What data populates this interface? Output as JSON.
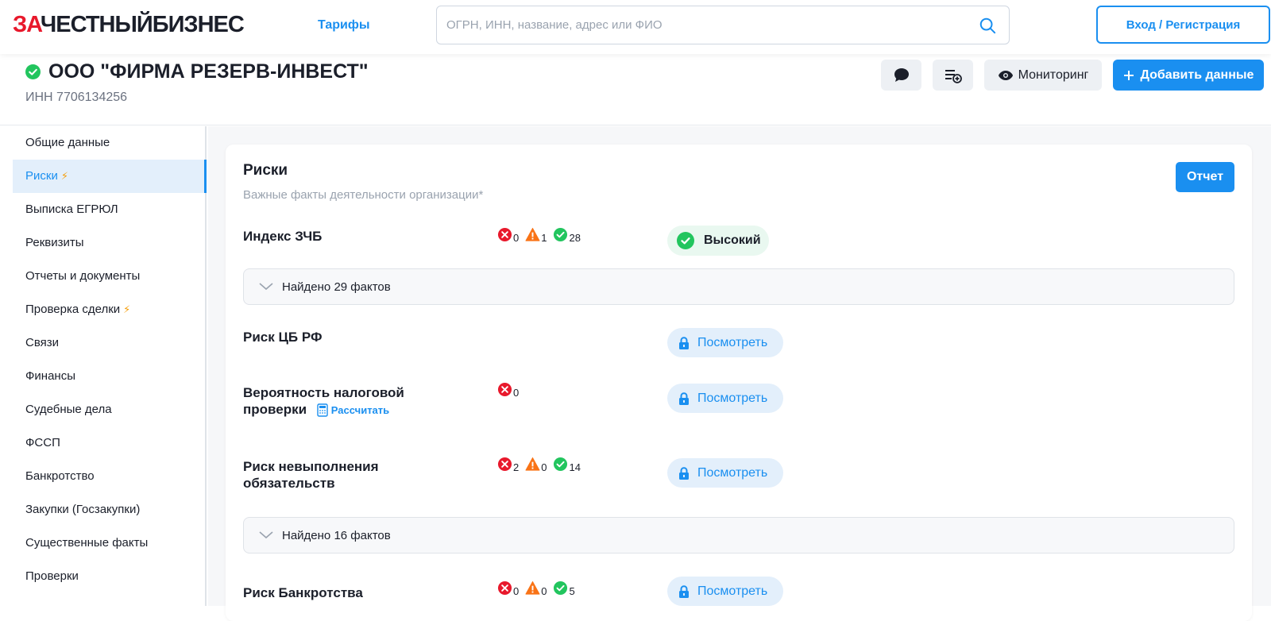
{
  "header": {
    "logo_red": "ЗА",
    "logo_dark": "ЧЕСТНЫЙБИЗНЕС",
    "tariffs": "Тарифы",
    "search_placeholder": "ОГРН, ИНН, название, адрес или ФИО",
    "login": "Вход / Регистрация",
    "colors": {
      "accent": "#1a8ff0",
      "logo_red": "#e8192c"
    }
  },
  "company": {
    "name": "ООО \"ФИРМА РЕЗЕРВ-ИНВЕСТ\"",
    "inn": "ИНН 7706134256",
    "status_icon": "verified-check-icon",
    "actions": {
      "comment_icon": "comment-icon",
      "add_to_list_icon": "add-to-list-icon",
      "monitoring": "Мониторинг",
      "add_data": "Добавить данные"
    }
  },
  "sidebar": {
    "items": [
      {
        "label": "Общие данные",
        "active": false,
        "bolt": false
      },
      {
        "label": "Риски",
        "active": true,
        "bolt": true
      },
      {
        "label": "Выписка ЕГРЮЛ",
        "active": false,
        "bolt": false
      },
      {
        "label": "Реквизиты",
        "active": false,
        "bolt": false
      },
      {
        "label": "Отчеты и документы",
        "active": false,
        "bolt": false
      },
      {
        "label": "Проверка сделки",
        "active": false,
        "bolt": true
      },
      {
        "label": "Связи",
        "active": false,
        "bolt": false
      },
      {
        "label": "Финансы",
        "active": false,
        "bolt": false
      },
      {
        "label": "Судебные дела",
        "active": false,
        "bolt": false
      },
      {
        "label": "ФССП",
        "active": false,
        "bolt": false
      },
      {
        "label": "Банкротство",
        "active": false,
        "bolt": false
      },
      {
        "label": "Закупки (Госзакупки)",
        "active": false,
        "bolt": false
      },
      {
        "label": "Существенные факты",
        "active": false,
        "bolt": false
      },
      {
        "label": "Проверки",
        "active": false,
        "bolt": false
      }
    ]
  },
  "risks": {
    "title": "Риски",
    "subtitle": "Важные факты деятельности организации*",
    "report": "Отчет",
    "index": {
      "label": "Индекс ЗЧБ",
      "red": "0",
      "orange": "1",
      "green": "28",
      "level": "Высокий",
      "found": "Найдено 29 фактов"
    },
    "cb": {
      "label": "Риск ЦБ РФ",
      "view": "Посмотреть"
    },
    "tax": {
      "label_line1": "Вероятность налоговой",
      "label_line2": "проверки",
      "calc": "Рассчитать",
      "red": "0",
      "view": "Посмотреть"
    },
    "obligations": {
      "label_line1": "Риск невыполнения",
      "label_line2": "обязательств",
      "red": "2",
      "orange": "0",
      "green": "14",
      "view": "Посмотреть",
      "found": "Найдено 16 фактов"
    },
    "bankruptcy": {
      "label": "Риск Банкротства",
      "red": "0",
      "orange": "0",
      "green": "5",
      "view": "Посмотреть"
    },
    "colors": {
      "red": "#e8192c",
      "orange": "#f97316",
      "green": "#22c55e"
    }
  }
}
